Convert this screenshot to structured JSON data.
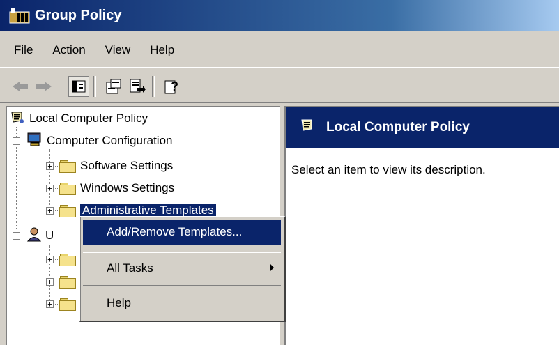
{
  "window": {
    "title": "Group Policy"
  },
  "menubar": {
    "items": [
      "File",
      "Action",
      "View",
      "Help"
    ]
  },
  "toolbar": {
    "buttons": [
      "back-icon",
      "forward-icon",
      "show-hide-tree-icon",
      "properties-icon",
      "export-list-icon",
      "help-icon"
    ]
  },
  "tree": {
    "root": "Local Computer Policy",
    "computer_config": "Computer Configuration",
    "software_settings": "Software Settings",
    "windows_settings": "Windows Settings",
    "admin_templates": "Administrative Templates",
    "user_config_partial": "U"
  },
  "right_pane": {
    "header": "Local Computer Policy",
    "description": "Select an item to view its description."
  },
  "context_menu": {
    "items": [
      {
        "label": "Add/Remove Templates...",
        "highlighted": true
      },
      {
        "label": "All Tasks",
        "submenu": true
      },
      {
        "label": "Help"
      }
    ]
  },
  "colors": {
    "selection": "#0a246a",
    "face": "#d4d0c8"
  }
}
